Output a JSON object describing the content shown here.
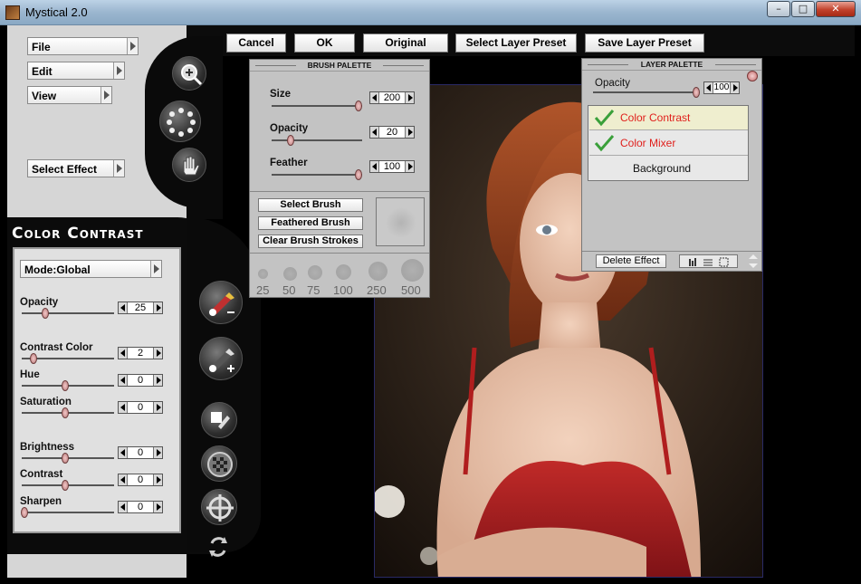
{
  "window": {
    "title": "Mystical 2.0",
    "minimize_icon": "minimize-icon",
    "maximize_icon": "maximize-icon",
    "close_icon": "close-icon"
  },
  "toolbar": {
    "cancel": "Cancel",
    "ok": "OK",
    "original": "Original",
    "select_preset": "Select Layer Preset",
    "save_preset": "Save Layer Preset"
  },
  "menu": {
    "file": "File",
    "edit": "Edit",
    "view": "View",
    "select_effect": "Select Effect"
  },
  "effect_panel": {
    "title": "Color Contrast",
    "mode": "Mode:Global",
    "sliders": [
      {
        "label": "Opacity",
        "value": "25"
      },
      {
        "label": "Contrast Color",
        "value": "2"
      },
      {
        "label": "Hue",
        "value": "0"
      },
      {
        "label": "Saturation",
        "value": "0"
      },
      {
        "label": "Brightness",
        "value": "0"
      },
      {
        "label": "Contrast",
        "value": "0"
      },
      {
        "label": "Sharpen",
        "value": "0"
      }
    ]
  },
  "brush_palette": {
    "title": "BRUSH PALETTE",
    "sliders": [
      {
        "label": "Size",
        "value": "200"
      },
      {
        "label": "Opacity",
        "value": "20"
      },
      {
        "label": "Feather",
        "value": "100"
      }
    ],
    "buttons": {
      "select": "Select Brush",
      "feathered": "Feathered Brush",
      "clear": "Clear Brush Strokes"
    },
    "sizes": [
      "25",
      "50",
      "75",
      "100",
      "250",
      "500"
    ]
  },
  "layer_palette": {
    "title": "LAYER PALETTE",
    "opacity_label": "Opacity",
    "opacity_value": "100",
    "layers": [
      {
        "name": "Color Contrast",
        "checked": true,
        "color": "#e0201c"
      },
      {
        "name": "Color Mixer",
        "checked": true,
        "color": "#e0201c"
      },
      {
        "name": "Background",
        "checked": false,
        "color": "#111111"
      }
    ],
    "delete_effect": "Delete Effect"
  },
  "colors": {
    "accent_red": "#e0201c",
    "panel_bg": "#c3c3c3",
    "check_green": "#3aa03a"
  }
}
